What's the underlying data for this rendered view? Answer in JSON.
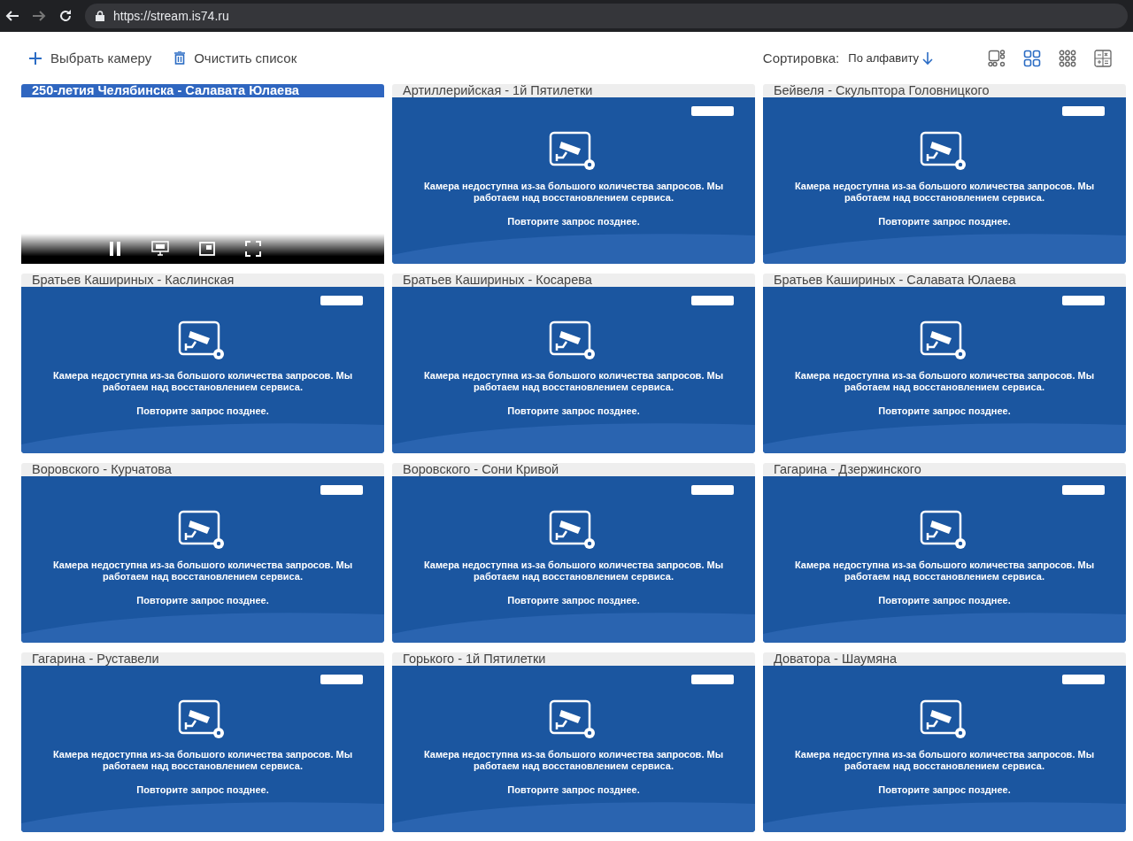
{
  "browser": {
    "url": "https://stream.is74.ru"
  },
  "toolbar": {
    "add_camera": "Выбрать камеру",
    "clear_list": "Очистить список",
    "sort_label": "Сортировка:",
    "sort_value": "По алфавиту",
    "view_modes": [
      {
        "kind": "large",
        "selected": false
      },
      {
        "kind": "grid4",
        "selected": true
      },
      {
        "kind": "grid9",
        "selected": false
      },
      {
        "kind": "calc",
        "selected": false
      }
    ]
  },
  "cameras": [
    {
      "title": "250-летия Челябинска - Салавата Юлаева",
      "selected": true,
      "kind": "live"
    },
    {
      "title": "Артиллерийская - 1й Пятилетки",
      "selected": false,
      "kind": "unavailable",
      "message": "Камера недоступна из-за большого количества запросов. Мы работаем над восстановлением сервиса.",
      "retry": "Повторите запрос позднее."
    },
    {
      "title": "Бейвеля - Скульптора Головницкого",
      "selected": false,
      "kind": "unavailable",
      "message": "Камера недоступна из-за большого количества запросов. Мы работаем над восстановлением сервиса.",
      "retry": "Повторите запрос позднее."
    },
    {
      "title": "Братьев Кашириных - Каслинская",
      "selected": false,
      "kind": "unavailable",
      "message": "Камера недоступна из-за большого количества запросов. Мы работаем над восстановлением сервиса.",
      "retry": "Повторите запрос позднее."
    },
    {
      "title": "Братьев Кашириных - Косарева",
      "selected": false,
      "kind": "unavailable",
      "message": "Камера недоступна из-за большого количества запросов. Мы работаем над восстановлением сервиса.",
      "retry": "Повторите запрос позднее."
    },
    {
      "title": "Братьев Кашириных - Салавата Юлаева",
      "selected": false,
      "kind": "unavailable",
      "message": "Камера недоступна из-за большого количества запросов. Мы работаем над восстановлением сервиса.",
      "retry": "Повторите запрос позднее."
    },
    {
      "title": "Воровского - Курчатова",
      "selected": false,
      "kind": "unavailable",
      "message": "Камера недоступна из-за большого количества запросов. Мы работаем над восстановлением сервиса.",
      "retry": "Повторите запрос позднее."
    },
    {
      "title": "Воровского - Сони Кривой",
      "selected": false,
      "kind": "unavailable",
      "message": "Камера недоступна из-за большого количества запросов. Мы работаем над восстановлением сервиса.",
      "retry": "Повторите запрос позднее."
    },
    {
      "title": "Гагарина - Дзержинского",
      "selected": false,
      "kind": "unavailable",
      "message": "Камера недоступна из-за большого количества запросов. Мы работаем над восстановлением сервиса.",
      "retry": "Повторите запрос позднее."
    },
    {
      "title": "Гагарина - Руставели",
      "selected": false,
      "kind": "unavailable",
      "message": "Камера недоступна из-за большого количества запросов. Мы работаем над восстановлением сервиса.",
      "retry": "Повторите запрос позднее."
    },
    {
      "title": "Горького - 1й Пятилетки",
      "selected": false,
      "kind": "unavailable",
      "message": "Камера недоступна из-за большого количества запросов. Мы работаем над восстановлением сервиса.",
      "retry": "Повторите запрос позднее."
    },
    {
      "title": "Доватора - Шаумяна",
      "selected": false,
      "kind": "unavailable",
      "message": "Камера недоступна из-за большого количества запросов. Мы работаем над восстановлением сервиса.",
      "retry": "Повторите запрос позднее."
    }
  ]
}
